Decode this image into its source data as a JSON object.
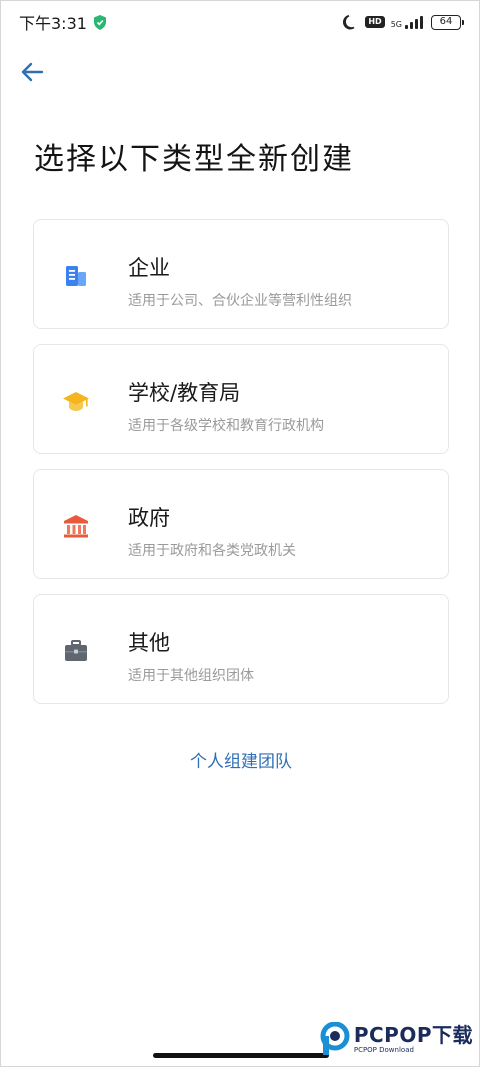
{
  "status_bar": {
    "time": "下午3:31",
    "network_gen": "5G",
    "battery": "64"
  },
  "header": {
    "back_icon": "arrow-left-icon",
    "title": "选择以下类型全新创建"
  },
  "options": [
    {
      "icon": "building-icon",
      "title": "企业",
      "desc": "适用于公司、合伙企业等营利性组织",
      "color": "#3b82f0"
    },
    {
      "icon": "graduation-cap-icon",
      "title": "学校/教育局",
      "desc": "适用于各级学校和教育行政机构",
      "color": "#f5b51f"
    },
    {
      "icon": "government-building-icon",
      "title": "政府",
      "desc": "适用于政府和各类党政机关",
      "color": "#ea5a3a"
    },
    {
      "icon": "briefcase-icon",
      "title": "其他",
      "desc": "适用于其他组织团体",
      "color": "#5f6670"
    }
  ],
  "personal_link": "个人组建团队",
  "watermark": {
    "main": "PCPOP下载",
    "sub": "PCPOP Download"
  }
}
